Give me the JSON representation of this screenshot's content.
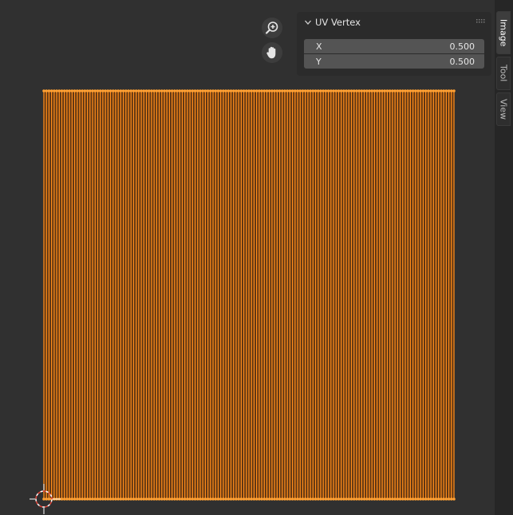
{
  "panel": {
    "title": "UV Vertex",
    "fields": [
      {
        "label": "X",
        "value": "0.500"
      },
      {
        "label": "Y",
        "value": "0.500"
      }
    ]
  },
  "sidebar_tabs": [
    {
      "label": "Image",
      "active": true
    },
    {
      "label": "Tool",
      "active": false
    },
    {
      "label": "View",
      "active": false
    }
  ],
  "navigation": {
    "zoom_icon": "zoom-in-icon",
    "pan_icon": "hand-pan-icon"
  },
  "colors": {
    "background": "#303030",
    "uv_edge": "#ff8c1a",
    "uv_vertex": "#ffa033",
    "panel_bg": "#2b2b2b",
    "field_bg": "#545454",
    "cursor_red": "#e0463a"
  }
}
